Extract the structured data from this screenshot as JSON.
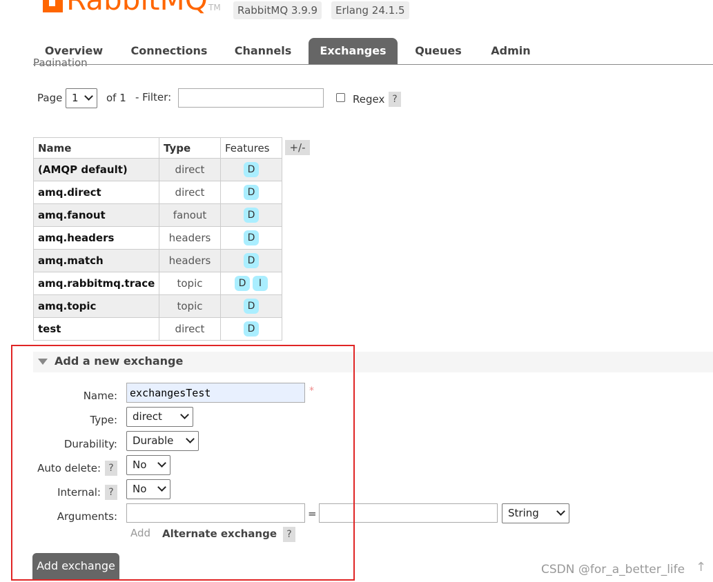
{
  "header": {
    "logo_text": "RabbitMQ",
    "tm": "TM",
    "rabbit_version": "RabbitMQ 3.9.9",
    "erlang_version": "Erlang 24.1.5"
  },
  "nav": {
    "tabs": [
      "Overview",
      "Connections",
      "Channels",
      "Exchanges",
      "Queues",
      "Admin"
    ],
    "active": "Exchanges"
  },
  "pagination": {
    "title": "Pagination",
    "page_label": "Page",
    "page_value": "1",
    "of_label": "of 1",
    "filter_label": "- Filter:",
    "filter_value": "",
    "regex_label": "Regex",
    "help": "?"
  },
  "table": {
    "headers": [
      "Name",
      "Type",
      "Features"
    ],
    "toggle": "+/-",
    "rows": [
      {
        "name": "(AMQP default)",
        "type": "direct",
        "features": [
          "D"
        ]
      },
      {
        "name": "amq.direct",
        "type": "direct",
        "features": [
          "D"
        ]
      },
      {
        "name": "amq.fanout",
        "type": "fanout",
        "features": [
          "D"
        ]
      },
      {
        "name": "amq.headers",
        "type": "headers",
        "features": [
          "D"
        ]
      },
      {
        "name": "amq.match",
        "type": "headers",
        "features": [
          "D"
        ]
      },
      {
        "name": "amq.rabbitmq.trace",
        "type": "topic",
        "features": [
          "D",
          "I"
        ]
      },
      {
        "name": "amq.topic",
        "type": "topic",
        "features": [
          "D"
        ]
      },
      {
        "name": "test",
        "type": "direct",
        "features": [
          "D"
        ]
      }
    ]
  },
  "add_exchange": {
    "title": "Add a new exchange",
    "name_label": "Name:",
    "name_value": "exchangesTest",
    "required_mark": "*",
    "type_label": "Type:",
    "type_value": "direct",
    "durability_label": "Durability:",
    "durability_value": "Durable",
    "auto_delete_label": "Auto delete:",
    "auto_delete_value": "No",
    "internal_label": "Internal:",
    "internal_value": "No",
    "arguments_label": "Arguments:",
    "equals": "=",
    "arg_type_value": "String",
    "add_link": "Add",
    "alternate_exchange": "Alternate exchange",
    "help": "?",
    "submit": "Add exchange"
  },
  "watermark": "CSDN @for_a_better_life",
  "colors": {
    "brand": "#ff6600",
    "tab_active": "#666666",
    "badge": "#aaeeff",
    "highlight_frame": "#e02424"
  }
}
